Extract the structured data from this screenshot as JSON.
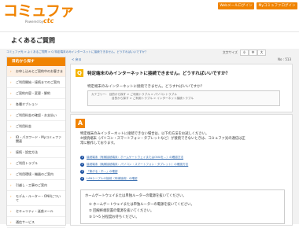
{
  "header": {
    "logo_text": "コミュファ",
    "logo_sub": "Powered by",
    "logo_brand": "ctc",
    "btn_webmail": "Webメールログイン",
    "btn_mypage": "Myコミュファログイン"
  },
  "page_title": "よくあるご質問",
  "breadcrumb": "コミュファ光 > よくあるご質問 > Q 特定端末のみインターネットに接続できません。どうすればいいですか？",
  "font_size": {
    "label": "文字サイズ",
    "small": "小",
    "medium": "中",
    "large": "大"
  },
  "sidebar": {
    "heading": "目的から探す",
    "items": [
      {
        "label": "お申し込みとご契約中のお客さま"
      },
      {
        "label": "ご利用開始・接続までのご案内"
      },
      {
        "label": "ご契約内容・変更・解約"
      },
      {
        "label": "各種オプション"
      },
      {
        "label": "ご利用料金の確認・お支払い"
      },
      {
        "label": "ご利用料金"
      },
      {
        "label": "ID・パスワード・Myコミュファ関連"
      },
      {
        "label": "接続・設定方法"
      },
      {
        "label": "ご利用トラブル"
      },
      {
        "label": "ご利用環境・機器のご案内"
      },
      {
        "label": "引越し・工事のご案内"
      },
      {
        "label": "モデム・ルーター・ONUについて"
      },
      {
        "label": "セキュリティ・迷惑メール"
      },
      {
        "label": "通信サービス"
      }
    ]
  },
  "main": {
    "back_link": "< 戻る",
    "faq_number": "No : 513",
    "question": {
      "icon": "Q",
      "title": "特定端末のみインターネットに接続できません。どうすればいいですか？",
      "body": "特定端末のみインターネットに接続できません。どうすればいいですか？",
      "categories": [
        "カテゴリー：  目的から探す > ご利用トラブル > パソコントラブル",
        "目的から探す > ご利用トラブル > インターネット接続トラブル"
      ]
    },
    "answer": {
      "icon": "A",
      "lines": [
        "特定端末のみインターネットに接続できない場合は、以下の方法をお試しください。",
        "※接続端末（パソコン・スマートフォン・タブレットなど）が接続できないときは、コミュファ光の通信は正",
        "常に動作しております。"
      ],
      "links": [
        {
          "num": "1",
          "text": "接続端末（有線接続端末：ホームゲートウェイまたはONUを…）の確認方法",
          "ext": ""
        },
        {
          "num": "2",
          "text": "接続端末（無線接続端末：パソコン・スマートフォン・タブレット）の確認方法",
          "ext": ""
        },
        {
          "num": "3",
          "text": "「繋がる・不…」の確認",
          "ext": ""
        },
        {
          "num": "4",
          "text": "LANケーブルの接続（有線接続）の確認",
          "ext": ""
        }
      ],
      "subbox": {
        "heading": "ホームゲートウェイまたは単独ルーターの電源を抜いてください。",
        "steps": [
          "① ホームゲートウェイまたは単独ルーターの電源を抜いてください。",
          "② 回線終端装置の電源を抜いてください。",
          "③ 1～5 分程度お待ちください。"
        ]
      }
    }
  }
}
